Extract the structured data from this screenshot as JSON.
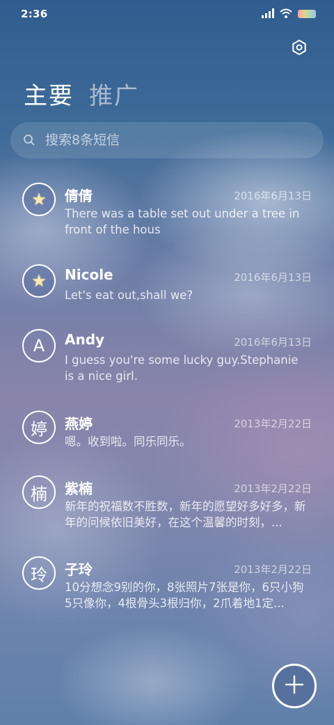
{
  "status_bar": {
    "time": "2:36",
    "icons": [
      "signal-icon",
      "wifi-icon",
      "battery-icon"
    ]
  },
  "header": {
    "settings_icon": "settings-icon"
  },
  "tabs": [
    {
      "label": "主要",
      "active": true
    },
    {
      "label": "推广",
      "active": false
    }
  ],
  "search": {
    "placeholder": "搜索8条短信",
    "icon": "search-icon"
  },
  "conversations": [
    {
      "avatar": "star",
      "name": "倩倩",
      "date": "2016年6月13日",
      "preview": "There was a table set out under a tree in front of the hous"
    },
    {
      "avatar": "star",
      "name": "Nicole",
      "date": "2016年6月13日",
      "preview": "Let's eat out,shall we?"
    },
    {
      "avatar": "A",
      "name": "Andy",
      "date": "2016年6月13日",
      "preview": "I guess you're some lucky guy.Stephanie is a nice girl."
    },
    {
      "avatar": "婷",
      "name": "燕婷",
      "date": "2013年2月22日",
      "preview": "嗯。收到啦。同乐同乐。"
    },
    {
      "avatar": "楠",
      "name": "紫楠",
      "date": "2013年2月22日",
      "preview": "新年的祝福数不胜数，新年的愿望好多好多，新年的问候依旧美好，在这个温馨的时刻，..."
    },
    {
      "avatar": "玲",
      "name": "子玲",
      "date": "2013年2月22日",
      "preview": "10分想念9别的你，8张照片7张是你，6只小狗5只像你，4根骨头3根归你，2爪着地1定..."
    }
  ],
  "fab": {
    "icon": "plus-icon"
  },
  "colors": {
    "fab_background": "#57719f",
    "star": "#fbeaa8"
  }
}
